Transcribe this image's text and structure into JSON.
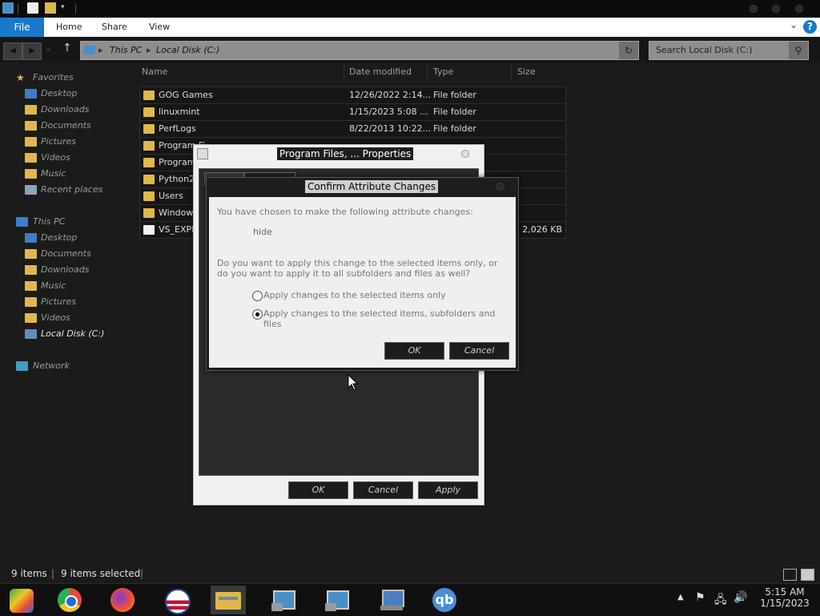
{
  "ribbon": {
    "file": "File",
    "tabs": [
      "Home",
      "Share",
      "View"
    ],
    "help": "?"
  },
  "address": {
    "crumbs": [
      "This PC",
      "Local Disk (C:)"
    ],
    "search_placeholder": "Search Local Disk (C:)"
  },
  "nav": {
    "favorites": "Favorites",
    "fav_items": [
      "Desktop",
      "Downloads",
      "Documents",
      "Pictures",
      "Videos",
      "Music",
      "Recent places"
    ],
    "this_pc": "This PC",
    "pc_items": [
      "Desktop",
      "Documents",
      "Downloads",
      "Music",
      "Pictures",
      "Videos",
      "Local Disk (C:)"
    ],
    "network": "Network"
  },
  "columns": {
    "name": "Name",
    "date": "Date modified",
    "type": "Type",
    "size": "Size"
  },
  "files": [
    {
      "name": "GOG Games",
      "date": "12/26/2022 2:14...",
      "type": "File folder",
      "size": ""
    },
    {
      "name": "linuxmint",
      "date": "1/15/2023 5:08 ...",
      "type": "File folder",
      "size": ""
    },
    {
      "name": "PerfLogs",
      "date": "8/22/2013 10:22...",
      "type": "File folder",
      "size": ""
    },
    {
      "name": "Program Fi",
      "date": "",
      "type": "",
      "size": ""
    },
    {
      "name": "Program",
      "date": "",
      "type": "",
      "size": ""
    },
    {
      "name": "Python2",
      "date": "",
      "type": "",
      "size": ""
    },
    {
      "name": "Users",
      "date": "",
      "type": "",
      "size": ""
    },
    {
      "name": "Window",
      "date": "",
      "type": "",
      "size": ""
    },
    {
      "name": "VS_EXPE",
      "date": "",
      "type": "",
      "size": "2,026 KB"
    }
  ],
  "properties_dialog": {
    "title": "Program Files, ... Properties",
    "ok": "OK",
    "cancel": "Cancel",
    "apply": "Apply"
  },
  "confirm_dialog": {
    "title": "Confirm Attribute Changes",
    "intro": "You have chosen to make the following attribute changes:",
    "change": "hide",
    "question": "Do you want to apply this change to the selected items only, or do you want to apply it to all subfolders and files as well?",
    "option1": "Apply changes to the selected items only",
    "option2": "Apply changes to the selected items, subfolders and files",
    "selected_option": 2,
    "ok": "OK",
    "cancel": "Cancel"
  },
  "status": {
    "count": "9 items",
    "selected": "9 items selected"
  },
  "taskbar": {
    "apps": [
      "chrome-os-icon",
      "chrome-icon",
      "firefox-icon",
      "obama-logo-icon",
      "file-explorer-icon",
      "setup-icon",
      "setup-icon-2",
      "network-computer-icon",
      "qbittorrent-icon"
    ],
    "qbit_label": "qb",
    "time": "5:15 AM",
    "date": "1/15/2023"
  },
  "colors": {
    "accent": "#1979ca",
    "folder": "#e0b84a"
  }
}
